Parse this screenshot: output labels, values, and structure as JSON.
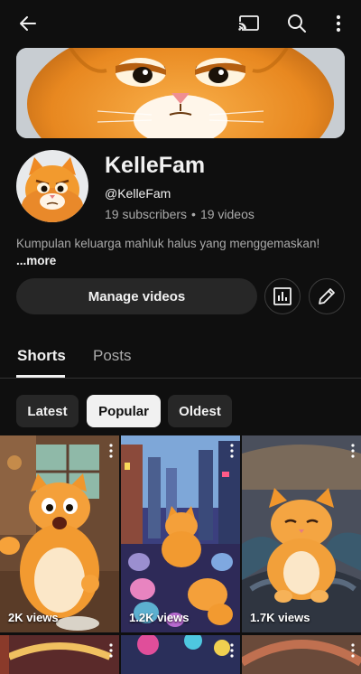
{
  "channel": {
    "name": "KelleFam",
    "handle": "@KelleFam",
    "subscribers": "19 subscribers",
    "separator": "•",
    "videos": "19 videos",
    "description": "Kumpulan keluarga mahluk halus yang menggemaskan!",
    "more_label": "...more"
  },
  "actions": {
    "manage_label": "Manage videos"
  },
  "tabs": [
    {
      "label": "Shorts",
      "selected": true
    },
    {
      "label": "Posts",
      "selected": false
    }
  ],
  "filters": [
    {
      "label": "Latest",
      "selected": false
    },
    {
      "label": "Popular",
      "selected": true
    },
    {
      "label": "Oldest",
      "selected": false
    }
  ],
  "shorts": [
    {
      "views": "2K views"
    },
    {
      "views": "1.2K views"
    },
    {
      "views": "1.7K views"
    }
  ],
  "icons": {
    "back": "arrow-left",
    "cast": "cast",
    "search": "magnifier",
    "more": "vertical-dots",
    "analytics": "bar-chart",
    "edit": "pencil"
  },
  "colors": {
    "background": "#0f0f0f",
    "surface": "#272727",
    "text": "#f1f1f1",
    "muted": "#aaaaaa"
  }
}
